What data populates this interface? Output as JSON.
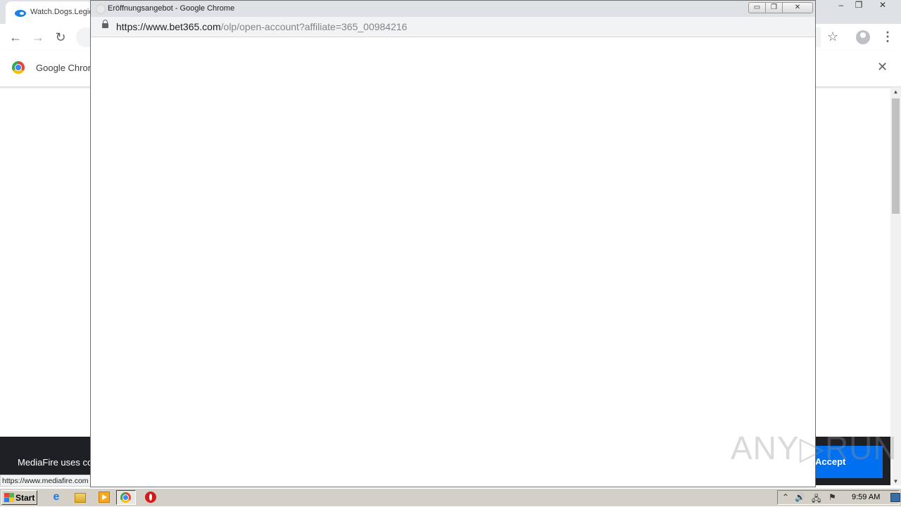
{
  "background_browser": {
    "tab_title": "Watch.Dogs.Legion",
    "window_controls": {
      "minimize": "‒",
      "restore": "❐",
      "close": "✕"
    },
    "nav": {
      "back": "←",
      "forward": "→",
      "reload": "↻"
    },
    "infobar_text": "Google Chrome",
    "infobar_close": "✕",
    "cookie_text": "MediaFire uses cookies",
    "cookie_accept": "Accept",
    "status_url": "https://www.mediafire.com"
  },
  "popup": {
    "title": "Eröffnungsangebot - Google Chrome",
    "url_domain": "https://www.bet365.com",
    "url_path": "/olp/open-account?affiliate=365_00984216",
    "controls": {
      "minimize": "▭",
      "maximize": "❐",
      "close": "✕"
    }
  },
  "watermark": "ANY▷RUN",
  "taskbar": {
    "start_label": "Start",
    "ie_glyph": "e",
    "clock": "9:59 AM",
    "tray": {
      "expand": "⌃",
      "volume": "🔊",
      "network": "🖧",
      "flag": "⚑"
    }
  }
}
